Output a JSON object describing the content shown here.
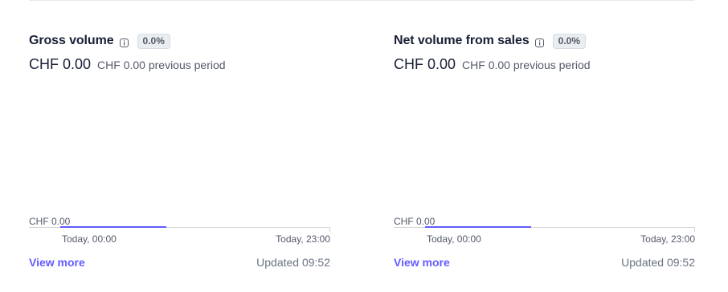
{
  "colors": {
    "accent": "#635bff",
    "text_primary": "#1a1f36",
    "text_secondary": "#545969",
    "badge_bg": "#ebeef1"
  },
  "cards": [
    {
      "title": "Gross volume",
      "info_icon": "info-icon",
      "change_badge": "0.0%",
      "value": "CHF 0.00",
      "previous": "CHF 0.00 previous period",
      "chart_y_label": "CHF 0.00",
      "chart_x_start": "Today, 00:00",
      "chart_x_end": "Today, 23:00",
      "view_more": "View more",
      "updated": "Updated 09:52"
    },
    {
      "title": "Net volume from sales",
      "info_icon": "info-icon",
      "change_badge": "0.0%",
      "value": "CHF 0.00",
      "previous": "CHF 0.00 previous period",
      "chart_y_label": "CHF 0.00",
      "chart_x_start": "Today, 00:00",
      "chart_x_end": "Today, 23:00",
      "view_more": "View more",
      "updated": "Updated 09:52"
    }
  ]
}
